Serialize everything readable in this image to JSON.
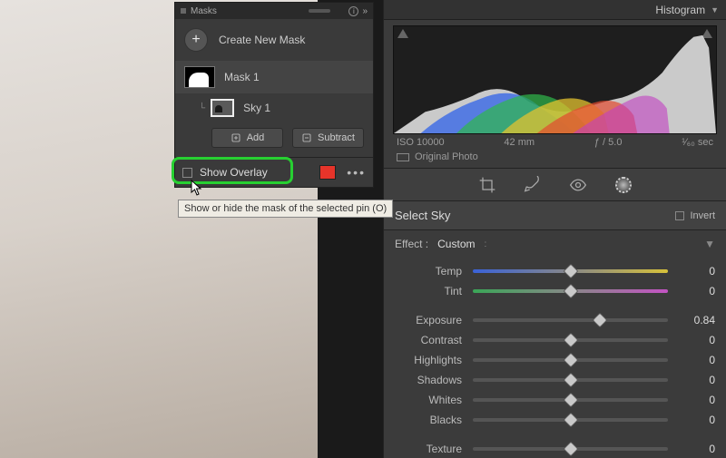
{
  "masks_panel": {
    "title": "Masks",
    "create_label": "Create New Mask",
    "mask1_label": "Mask 1",
    "sky_label": "Sky 1",
    "add_label": "Add",
    "subtract_label": "Subtract",
    "show_overlay_label": "Show Overlay",
    "overlay_color": "#e6342a",
    "tooltip": "Show or hide the mask of the selected pin (O)"
  },
  "histogram": {
    "title": "Histogram",
    "iso": "ISO 10000",
    "focal": "42 mm",
    "aperture": "ƒ / 5.0",
    "shutter": "¹⁄₆₀ sec",
    "original_label": "Original Photo"
  },
  "adjust": {
    "section_title": "Select Sky",
    "invert_label": "Invert",
    "effect_label": "Effect :",
    "effect_value": "Custom",
    "sliders": {
      "temp": {
        "label": "Temp",
        "value": "0",
        "pos": 50
      },
      "tint": {
        "label": "Tint",
        "value": "0",
        "pos": 50
      },
      "exposure": {
        "label": "Exposure",
        "value": "0.84",
        "pos": 65
      },
      "contrast": {
        "label": "Contrast",
        "value": "0",
        "pos": 50
      },
      "highlights": {
        "label": "Highlights",
        "value": "0",
        "pos": 50
      },
      "shadows": {
        "label": "Shadows",
        "value": "0",
        "pos": 50
      },
      "whites": {
        "label": "Whites",
        "value": "0",
        "pos": 50
      },
      "blacks": {
        "label": "Blacks",
        "value": "0",
        "pos": 50
      },
      "texture": {
        "label": "Texture",
        "value": "0",
        "pos": 50
      }
    }
  }
}
